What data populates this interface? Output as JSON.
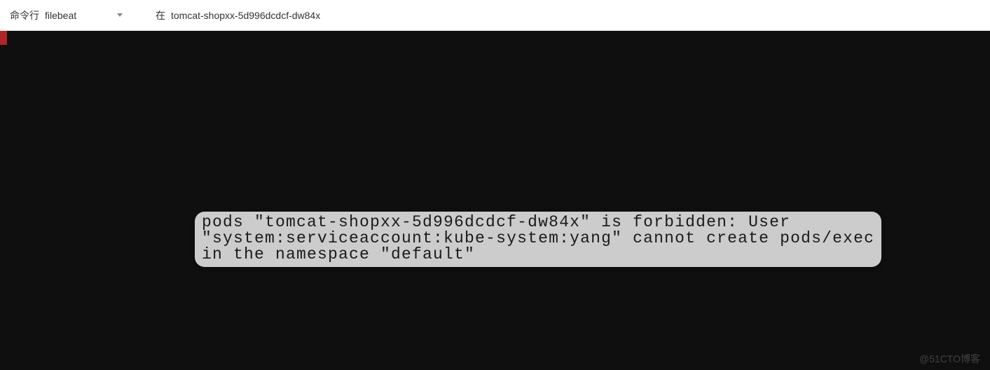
{
  "toolbar": {
    "command_line_label": "命令行",
    "selected_container": "filebeat",
    "at_label": "在",
    "pod_name": "tomcat-shopxx-5d996dcdcf-dw84x"
  },
  "terminal": {
    "error_tooltip": "pods \"tomcat-shopxx-5d996dcdcf-dw84x\" is forbidden: User\n\"system:serviceaccount:kube-system:yang\" cannot create pods/exec\nin the namespace \"default\""
  },
  "watermark": "@51CTO博客"
}
